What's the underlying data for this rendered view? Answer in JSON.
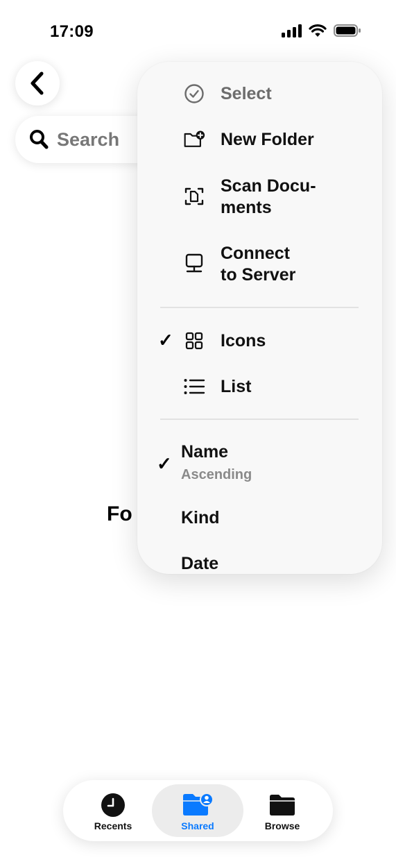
{
  "status_bar": {
    "time": "17:09"
  },
  "search": {
    "placeholder": "Search"
  },
  "empty_state": {
    "text": "Fo"
  },
  "menu": {
    "actions": [
      {
        "label": "Select",
        "icon": "checkmark-circle-icon"
      },
      {
        "label": "New Folder",
        "icon": "folder-plus-icon"
      },
      {
        "label_line1": "Scan Docu-",
        "label_line2": "ments",
        "icon": "scan-document-icon"
      },
      {
        "label_line1": "Connect",
        "label_line2": "to Server",
        "icon": "server-icon"
      }
    ],
    "view_options": [
      {
        "label": "Icons",
        "selected": true,
        "icon": "grid-icon"
      },
      {
        "label": "List",
        "selected": false,
        "icon": "list-icon"
      }
    ],
    "sort_options": [
      {
        "label": "Name",
        "sublabel": "Ascending",
        "selected": true
      },
      {
        "label": "Kind",
        "selected": false
      },
      {
        "label": "Date",
        "selected": false
      }
    ],
    "check_mark": "✓"
  },
  "tab_bar": {
    "tabs": [
      {
        "label": "Recents",
        "icon": "clock-icon",
        "active": false
      },
      {
        "label": "Shared",
        "icon": "shared-folder-icon",
        "active": true
      },
      {
        "label": "Browse",
        "icon": "folder-icon",
        "active": false
      }
    ],
    "active_color": "#0a7aff"
  }
}
